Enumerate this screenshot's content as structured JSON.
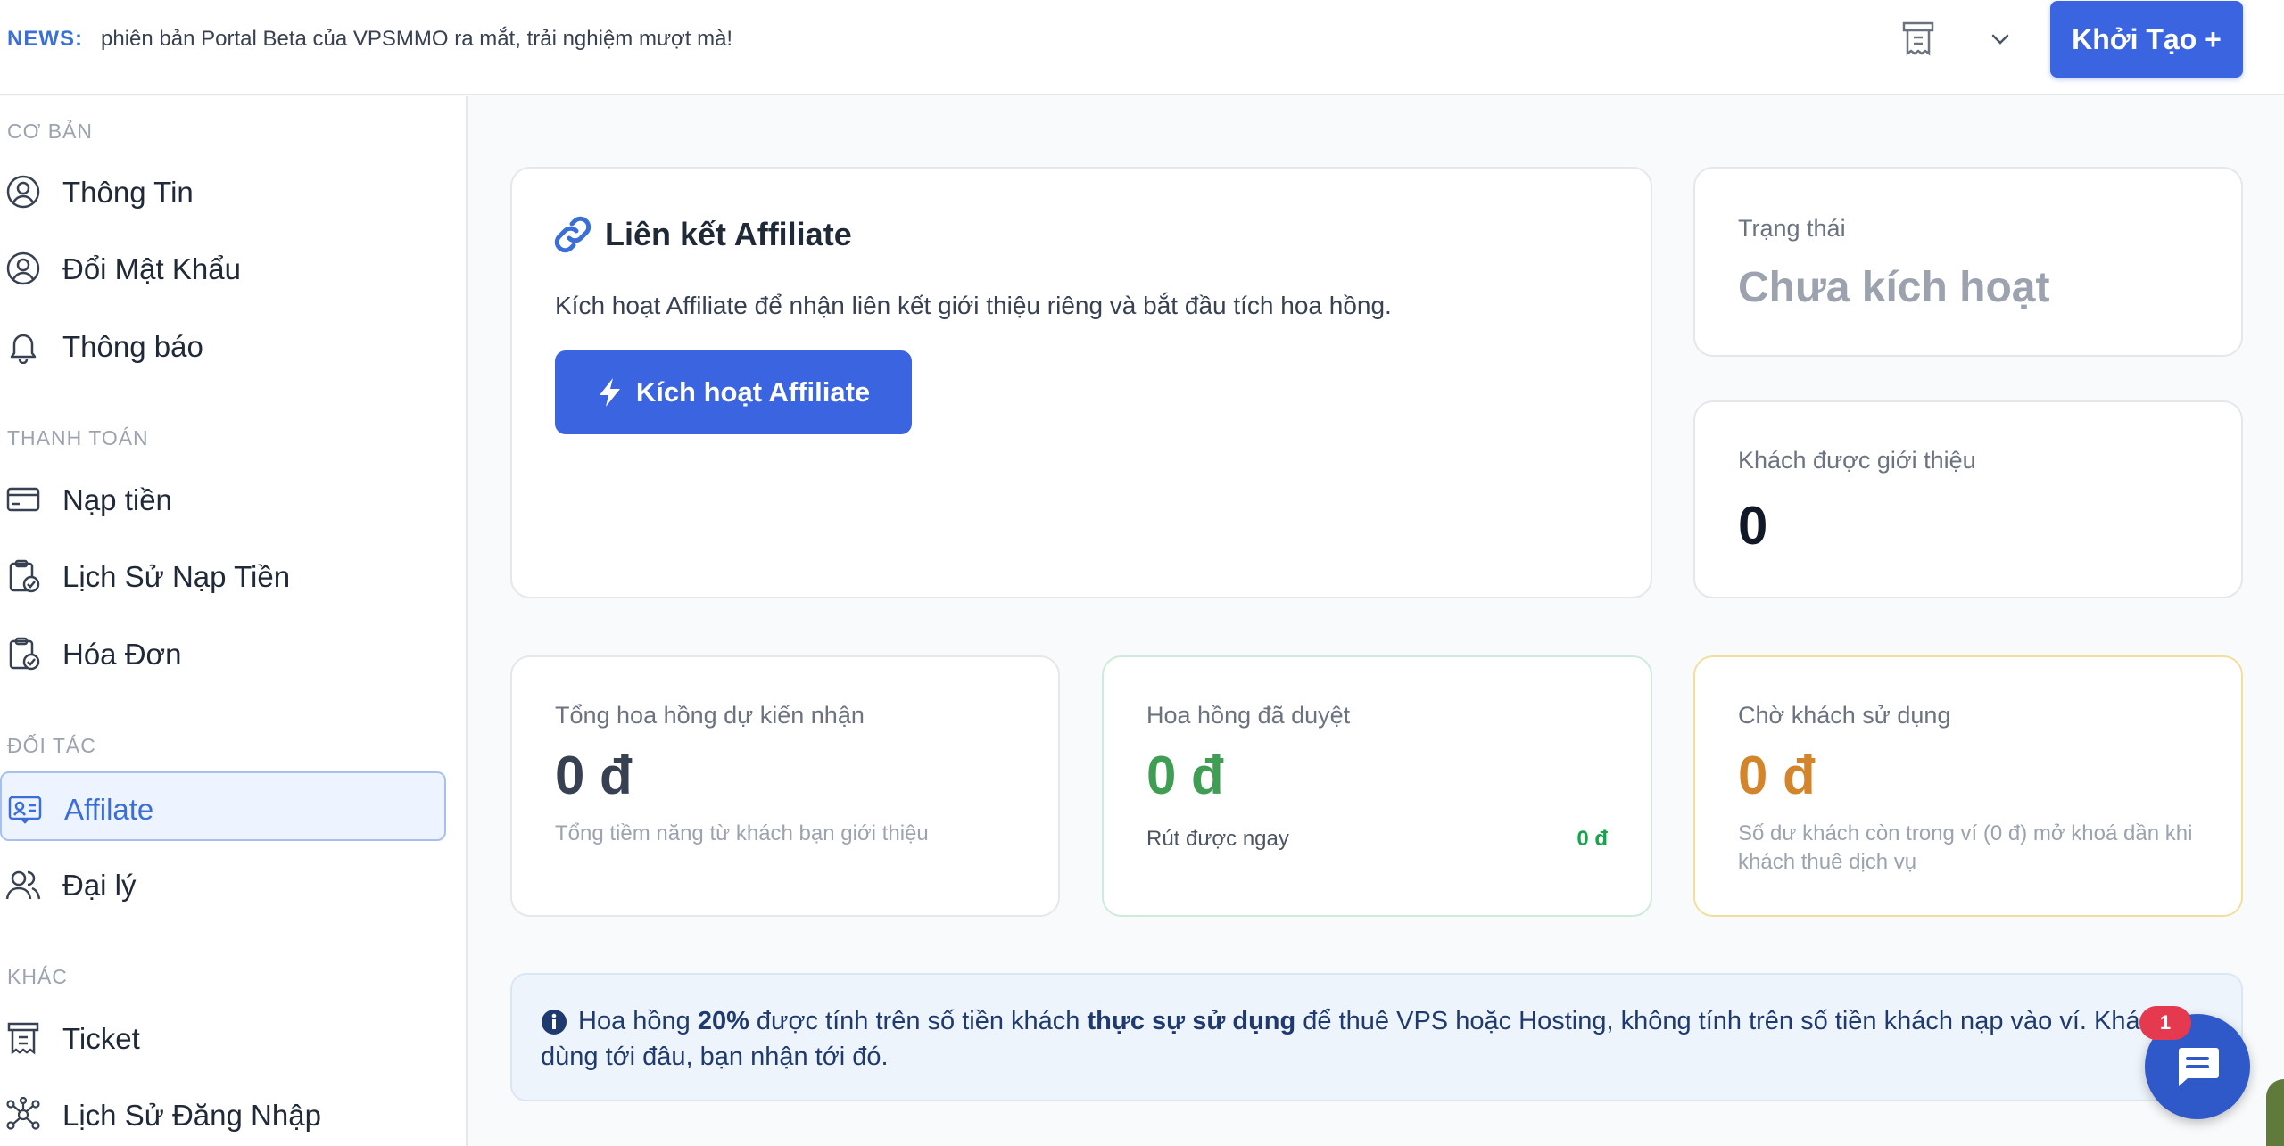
{
  "news": {
    "label": "NEWS:",
    "text": "phiên bản Portal Beta của VPSMMO ra mắt, trải nghiệm mượt mà!"
  },
  "topbar": {
    "ticket_icon": "ticket-icon",
    "dropdown_icon": "chevron-down-icon",
    "create_label": "Khởi Tạo +"
  },
  "sidebar": {
    "sections": [
      {
        "title": "CƠ BẢN",
        "items": [
          {
            "label": "Thông Tin",
            "icon": "user-circle-icon"
          },
          {
            "label": "Đổi Mật Khẩu",
            "icon": "user-circle-icon"
          },
          {
            "label": "Thông báo",
            "icon": "bell-icon"
          }
        ]
      },
      {
        "title": "THANH TOÁN",
        "items": [
          {
            "label": "Nạp tiền",
            "icon": "credit-card-icon"
          },
          {
            "label": "Lịch Sử Nạp Tiền",
            "icon": "clipboard-check-icon"
          },
          {
            "label": "Hóa Đơn",
            "icon": "clipboard-check-icon"
          }
        ]
      },
      {
        "title": "ĐỐI TÁC",
        "items": [
          {
            "label": "Affilate",
            "icon": "id-card-icon",
            "active": true
          },
          {
            "label": "Đại lý",
            "icon": "users-icon"
          }
        ]
      },
      {
        "title": "KHÁC",
        "items": [
          {
            "label": "Ticket",
            "icon": "ticket-icon"
          },
          {
            "label": "Lịch Sử Đăng Nhập",
            "icon": "network-icon"
          }
        ]
      }
    ]
  },
  "affiliate": {
    "title": "Liên kết Affiliate",
    "description": "Kích hoạt Affiliate để nhận liên kết giới thiệu riêng và bắt đầu tích hoa hồng.",
    "button_label": "Kích hoạt Affiliate"
  },
  "status": {
    "label": "Trạng thái",
    "value": "Chưa kích hoạt"
  },
  "referrals": {
    "label": "Khách được giới thiệu",
    "value": "0"
  },
  "total_commission": {
    "label": "Tổng hoa hồng dự kiến nhận",
    "value": "0 đ",
    "note": "Tổng tiềm năng từ khách bạn giới thiệu",
    "color": "#374151"
  },
  "approved_commission": {
    "label": "Hoa hồng đã duyệt",
    "value": "0 đ",
    "withdraw_label": "Rút được ngay",
    "withdraw_value": "0 đ",
    "color": "#3f9e54"
  },
  "waiting_commission": {
    "label": "Chờ khách sử dụng",
    "value": "0 đ",
    "note": "Số dư khách còn trong ví (0 đ) mở khoá dần khi khách thuê dịch vụ",
    "color": "#d2852b"
  },
  "info": {
    "part1": "Hoa hồng ",
    "percent": "20%",
    "part2": " được tính trên số tiền khách ",
    "emphasis": "thực sự sử dụng",
    "part3": " để thuê VPS hoặc Hosting, không tính trên số tiền khách nạp vào ví. Khách dùng tới đâu, bạn nhận tới đó."
  },
  "chat": {
    "badge": "1",
    "icon": "chat-bubble-icon"
  }
}
